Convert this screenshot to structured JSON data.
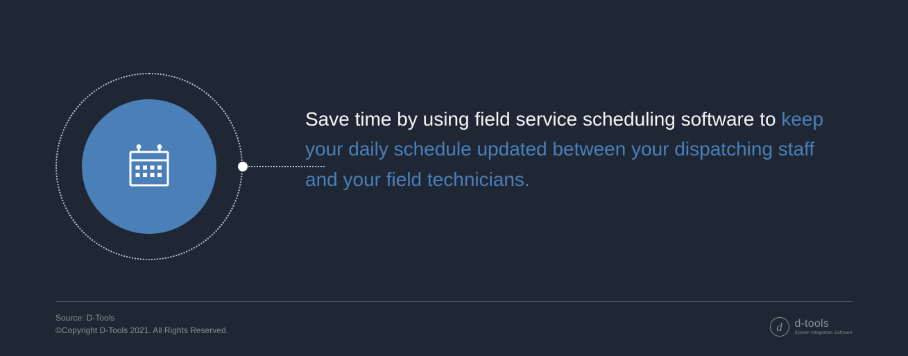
{
  "icon": {
    "name": "calendar-icon"
  },
  "copy": {
    "normal": "Save time by using field service scheduling software to ",
    "highlight": "keep your daily schedule updated between your dispatching staff and your field technicians."
  },
  "footer": {
    "source": "Source: D-Tools",
    "copyright": "©Copyright D-Tools 2021. All Rights Reserved."
  },
  "logo": {
    "mark": "d",
    "name": "d-tools",
    "tagline": "System Integration Software"
  }
}
